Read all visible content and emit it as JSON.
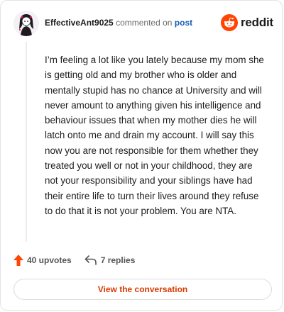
{
  "comment": {
    "username": "EffectiveAnt9025",
    "action": "commented on",
    "link_text": "post",
    "body": "I’m feeling a lot like you lately because my mom she is getting old and my brother who is older and mentally stupid has no chance at University and will never amount to anything given his intelligence and behaviour issues that when my mother dies he will latch onto me and drain my account. I will say this now you are not responsible for them whether they treated you well or not in your childhood, they are not your responsibility and your siblings have had their entire life to turn their lives around they refuse to do that it is not your problem. You are NTA."
  },
  "brand": {
    "wordmark": "reddit",
    "logo_icon": "reddit-snoo-icon",
    "color": "#ff4500"
  },
  "stats": {
    "upvotes": "40 upvotes",
    "replies": "7 replies",
    "upvote_icon": "upvote-arrow-icon",
    "reply_icon": "reply-arrow-icon",
    "upvote_color": "#ff4500"
  },
  "cta": {
    "label": "View the conversation",
    "color": "#d93a00"
  }
}
